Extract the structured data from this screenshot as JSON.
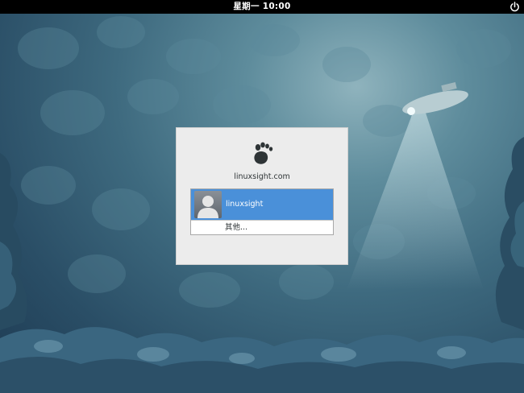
{
  "topbar": {
    "clock": "星期一 10:00",
    "power_icon": "power-icon"
  },
  "login": {
    "logo_icon": "gnome-foot-icon",
    "hostname": "linuxsight.com",
    "users": [
      {
        "name": "linuxsight",
        "avatar_icon": "user-avatar-icon",
        "selected": true
      }
    ],
    "other_label": "其他..."
  },
  "colors": {
    "topbar": "#000000",
    "selection": "#4a90d9",
    "dialog_bg": "#ececec"
  }
}
